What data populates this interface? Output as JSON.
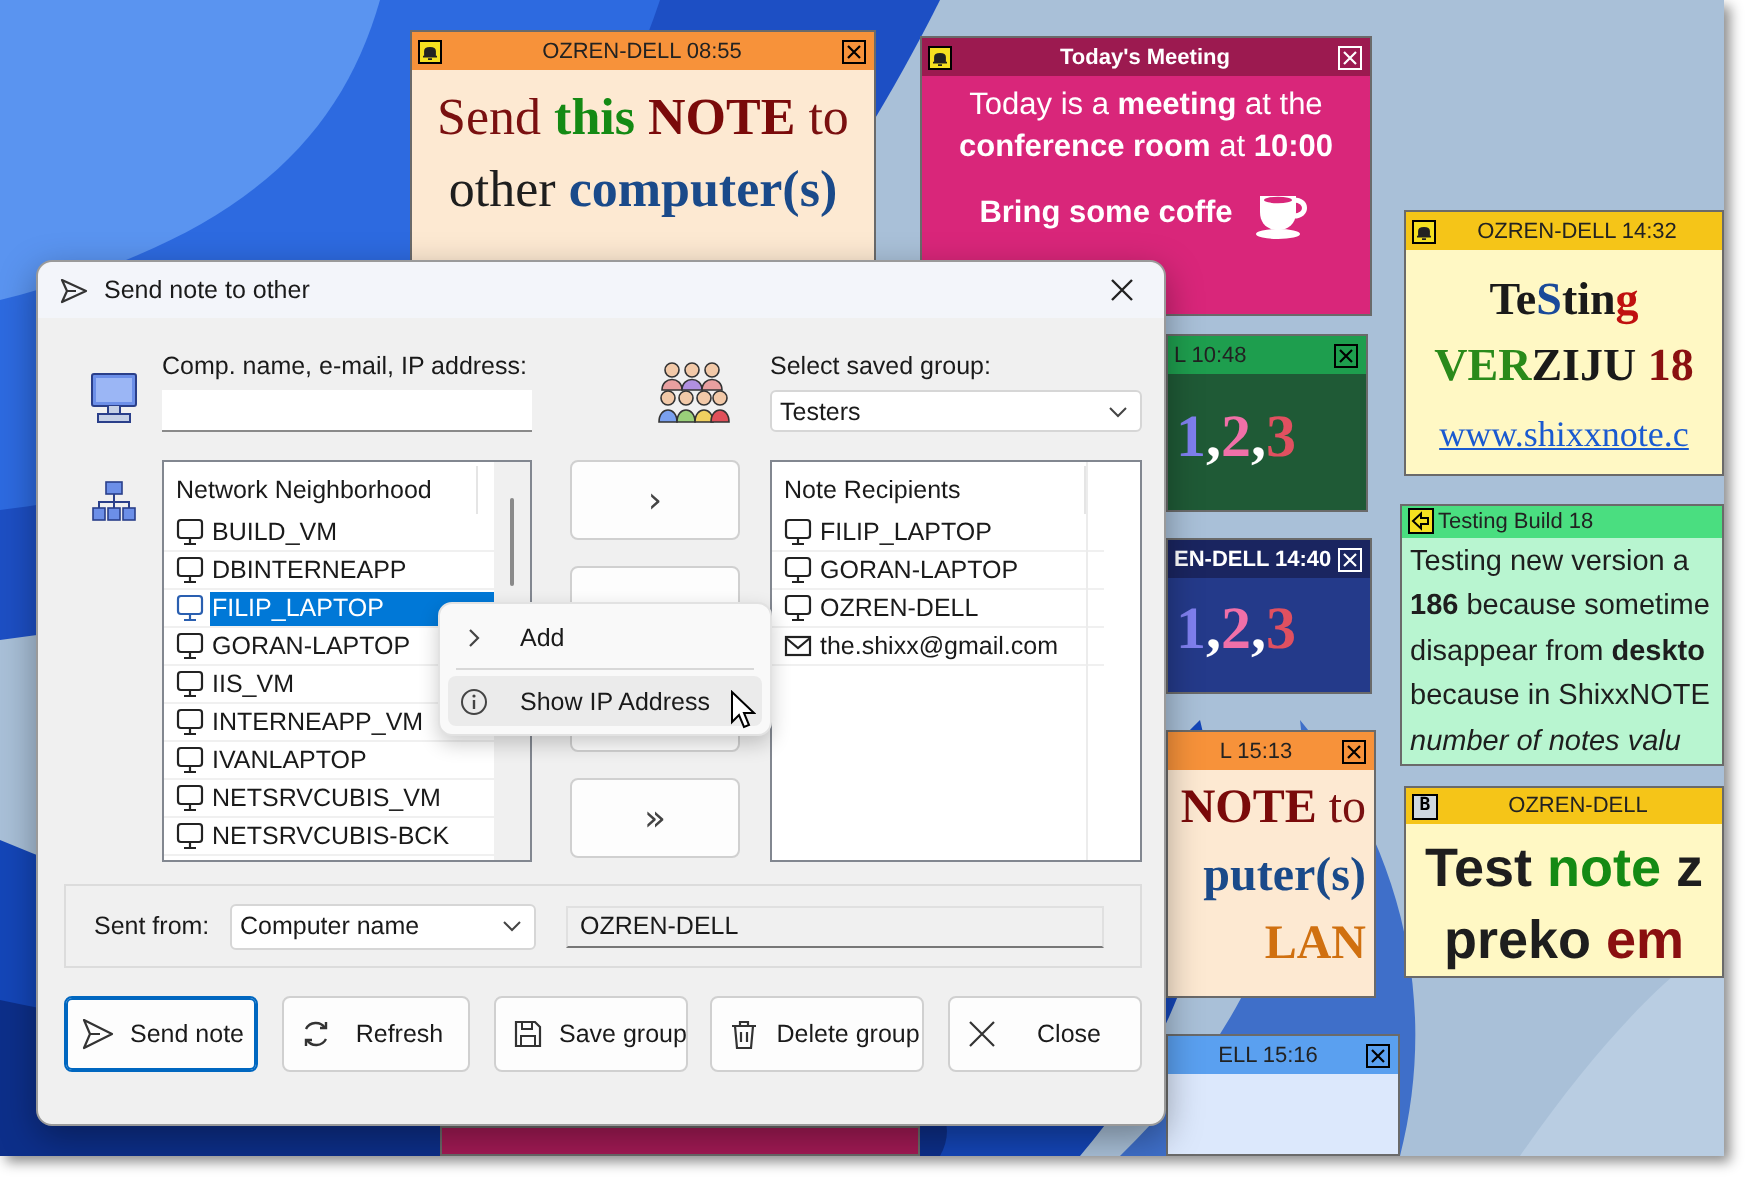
{
  "desktop": {
    "notes": [
      {
        "kind": "bell",
        "title": "OZREN-DELL 08:55",
        "color": "#f7923a",
        "body": {
          "color": "#fde9d2"
        },
        "close_box": true,
        "lines": [
          {
            "kind": "text",
            "runs": [
              {
                "text": "Send ",
                "color": "#7a1010"
              },
              {
                "text": "this ",
                "color": "#148a14",
                "bold": true
              },
              {
                "text": "NOTE",
                "color": "#7a0a0a",
                "bold": true
              },
              {
                "text": " to",
                "color": "#7a1010"
              }
            ]
          },
          {
            "kind": "text",
            "runs": [
              {
                "text": "other ",
                "color": "#1e1e1e"
              },
              {
                "text": "computer(s)",
                "color": "#1a4a8a",
                "bold": true
              }
            ]
          }
        ]
      },
      {
        "kind": "bell",
        "title": "Today's Meeting",
        "color": "#9c1a50",
        "body": {
          "color": "#d9267a"
        },
        "close_box": true,
        "lines": [
          {
            "kind": "text",
            "runs": [
              {
                "text": "Today is a ",
                "color": "#ffffff"
              },
              {
                "text": "meeting",
                "color": "#ffffff",
                "bold": true
              },
              {
                "text": " at the",
                "color": "#ffffff"
              }
            ]
          },
          {
            "kind": "text",
            "runs": [
              {
                "text": "conference room",
                "color": "#ffffff",
                "bold": true
              },
              {
                "text": " at ",
                "color": "#ffffff"
              },
              {
                "text": "10:00",
                "color": "#ffffff",
                "bold": true
              }
            ]
          },
          {
            "kind": "cup",
            "runs": [
              {
                "text": "Bring some coffe",
                "color": "#ffffff",
                "bold": true
              }
            ]
          }
        ]
      },
      {
        "kind": "bell",
        "title": "OZREN-DELL 14:32",
        "color": "#f5c518",
        "body": {
          "color": "#fff8c4"
        },
        "close_box": false,
        "lines": [
          {
            "kind": "text",
            "runs": [
              {
                "text": "Te",
                "color": "#1a1a1a",
                "bold": true
              },
              {
                "text": "S",
                "color": "#1a4a9a",
                "bold": true
              },
              {
                "text": "tin",
                "color": "#1a1a1a",
                "bold": true
              },
              {
                "text": "g",
                "color": "#c01010",
                "bold": true
              }
            ]
          },
          {
            "kind": "text",
            "runs": [
              {
                "text": "VER",
                "color": "#2a8a1a",
                "bold": true
              },
              {
                "text": "ZIJU ",
                "color": "#1a1a1a",
                "bold": true
              },
              {
                "text": "18",
                "color": "#8a1010",
                "bold": true
              }
            ]
          },
          {
            "kind": "link",
            "runs": [
              {
                "text": "www.shixxnote.c",
                "color": "#1a5ad0"
              }
            ]
          }
        ]
      },
      {
        "kind": "plain",
        "title": "L 10:48",
        "color": "#1e9e4e",
        "body": {
          "color": "#1f5a36"
        },
        "close_box": true,
        "lines": [
          {
            "kind": "text",
            "runs": [
              {
                "text": "1",
                "color": "#8080f0",
                "bold": true
              },
              {
                "text": ",",
                "color": "#ffffff",
                "bold": true
              },
              {
                "text": "2",
                "color": "#f070a8",
                "bold": true
              },
              {
                "text": ",",
                "color": "#ffffff",
                "bold": true
              },
              {
                "text": "3",
                "color": "#e05060",
                "bold": true
              }
            ]
          }
        ]
      },
      {
        "kind": "plain",
        "title": "EN-DELL 14:40",
        "color": "#1a2560",
        "body": {
          "color": "#243a8a"
        },
        "close_box": true,
        "lines": [
          {
            "kind": "text",
            "runs": [
              {
                "text": "1",
                "color": "#8080f0",
                "bold": true
              },
              {
                "text": ",",
                "color": "#ffffff",
                "bold": true
              },
              {
                "text": "2",
                "color": "#f070a8",
                "bold": true
              },
              {
                "text": ",",
                "color": "#ffffff",
                "bold": true
              },
              {
                "text": "3",
                "color": "#e05060",
                "bold": true
              }
            ]
          }
        ]
      },
      {
        "kind": "arrow",
        "title": "Testing Build 18",
        "color": "#4ade80",
        "body": {
          "color": "#b8f5d0"
        },
        "close_box": false,
        "lines": [
          {
            "kind": "text",
            "runs": [
              {
                "text": "Testing new version a",
                "color": "#1e1e1e"
              }
            ]
          },
          {
            "kind": "text",
            "runs": [
              {
                "text": "186",
                "color": "#1e1e1e",
                "bold": true
              },
              {
                "text": " because sometime",
                "color": "#1e1e1e"
              }
            ]
          },
          {
            "kind": "text",
            "runs": [
              {
                "text": "disappear from ",
                "color": "#1e1e1e"
              },
              {
                "text": "deskto",
                "color": "#1e1e1e",
                "bold": true
              }
            ]
          },
          {
            "kind": "text",
            "runs": [
              {
                "text": "because in ShixxNOTE",
                "color": "#1e1e1e"
              }
            ]
          },
          {
            "kind": "text",
            "runs": [
              {
                "text": "number of notes valu",
                "color": "#1e1e1e",
                "italic": true
              }
            ]
          }
        ]
      },
      {
        "kind": "plain",
        "title": "L 15:13",
        "color": "#f7923a",
        "body": {
          "color": "#fde9d2"
        },
        "close_box": true,
        "lines": [
          {
            "kind": "text",
            "runs": [
              {
                "text": "NOTE",
                "color": "#7a0a0a",
                "bold": true
              },
              {
                "text": " to",
                "color": "#7a1010"
              }
            ]
          },
          {
            "kind": "text",
            "runs": [
              {
                "text": "puter(s)",
                "color": "#1a4a8a",
                "bold": true
              }
            ]
          },
          {
            "kind": "text",
            "runs": [
              {
                "text": "LAN",
                "color": "#d07010",
                "bold": true
              }
            ]
          }
        ]
      },
      {
        "kind": "badge",
        "badge": "B",
        "title": "OZREN-DELL",
        "color": "#f5c518",
        "body": {
          "color": "#fff8c4"
        },
        "close_box": false,
        "lines": [
          {
            "kind": "text",
            "runs": [
              {
                "text": "Test ",
                "color": "#1e1e1e",
                "bold": true
              },
              {
                "text": "note",
                "color": "#148a14",
                "bold": true
              },
              {
                "text": " z",
                "color": "#1e1e1e",
                "bold": true
              }
            ]
          },
          {
            "kind": "text",
            "runs": [
              {
                "text": "preko ",
                "color": "#1e1e1e",
                "bold": true
              },
              {
                "text": "em",
                "color": "#8a1010",
                "bold": true
              }
            ]
          }
        ]
      },
      {
        "kind": "plain",
        "title": "ELL 15:16",
        "color": "#5aa0f0",
        "body": {
          "color": "#dce8fc"
        },
        "close_box": true
      },
      {
        "kind": "edge",
        "color": "#a31a55"
      }
    ]
  },
  "dialog": {
    "title": "Send note to other",
    "address": {
      "label": "Comp. name, e-mail, IP address:"
    },
    "group": {
      "label": "Select saved group:",
      "value": "Testers"
    },
    "network": {
      "header": "Network Neighborhood",
      "items": [
        {
          "name": "BUILD_VM",
          "selected": false
        },
        {
          "name": "DBINTERNEAPP",
          "selected": false
        },
        {
          "name": "FILIP_LAPTOP",
          "selected": true
        },
        {
          "name": "GORAN-LAPTOP",
          "selected": false
        },
        {
          "name": "IIS_VM",
          "selected": false
        },
        {
          "name": "INTERNEAPP_VM",
          "selected": false
        },
        {
          "name": "IVANLAPTOP",
          "selected": false
        },
        {
          "name": "NETSRVCUBIS_VM",
          "selected": false
        },
        {
          "name": "NETSRVCUBIS-BCK",
          "selected": false
        }
      ]
    },
    "transfer_buttons": [
      {
        "kind": "label",
        "label": "›"
      },
      {
        "kind": "covered"
      },
      {
        "kind": "covered"
      },
      {
        "kind": "label",
        "label": "»"
      }
    ],
    "recipients": {
      "header": "Note Recipients",
      "items": [
        {
          "name": "FILIP_LAPTOP",
          "kind": "computer"
        },
        {
          "name": "GORAN-LAPTOP",
          "kind": "computer"
        },
        {
          "name": "OZREN-DELL",
          "kind": "computer"
        },
        {
          "name": "the.shixx@gmail.com",
          "kind": "email"
        }
      ]
    },
    "sent_from": {
      "label": "Sent from:",
      "mode": "Computer name",
      "value": "OZREN-DELL"
    },
    "buttons": [
      {
        "label": "Send note",
        "kind": "send",
        "default": true
      },
      {
        "label": "Refresh",
        "kind": "refresh",
        "default": false
      },
      {
        "label": "Save group",
        "kind": "save",
        "default": false
      },
      {
        "label": "Delete group",
        "kind": "delete",
        "default": false
      },
      {
        "label": "Close",
        "kind": "close",
        "default": false
      }
    ],
    "context_menu": [
      {
        "label": "Add",
        "kind": "submenu",
        "hovered": false
      },
      {
        "label": "Show IP Address",
        "kind": "info",
        "hovered": true
      }
    ]
  }
}
